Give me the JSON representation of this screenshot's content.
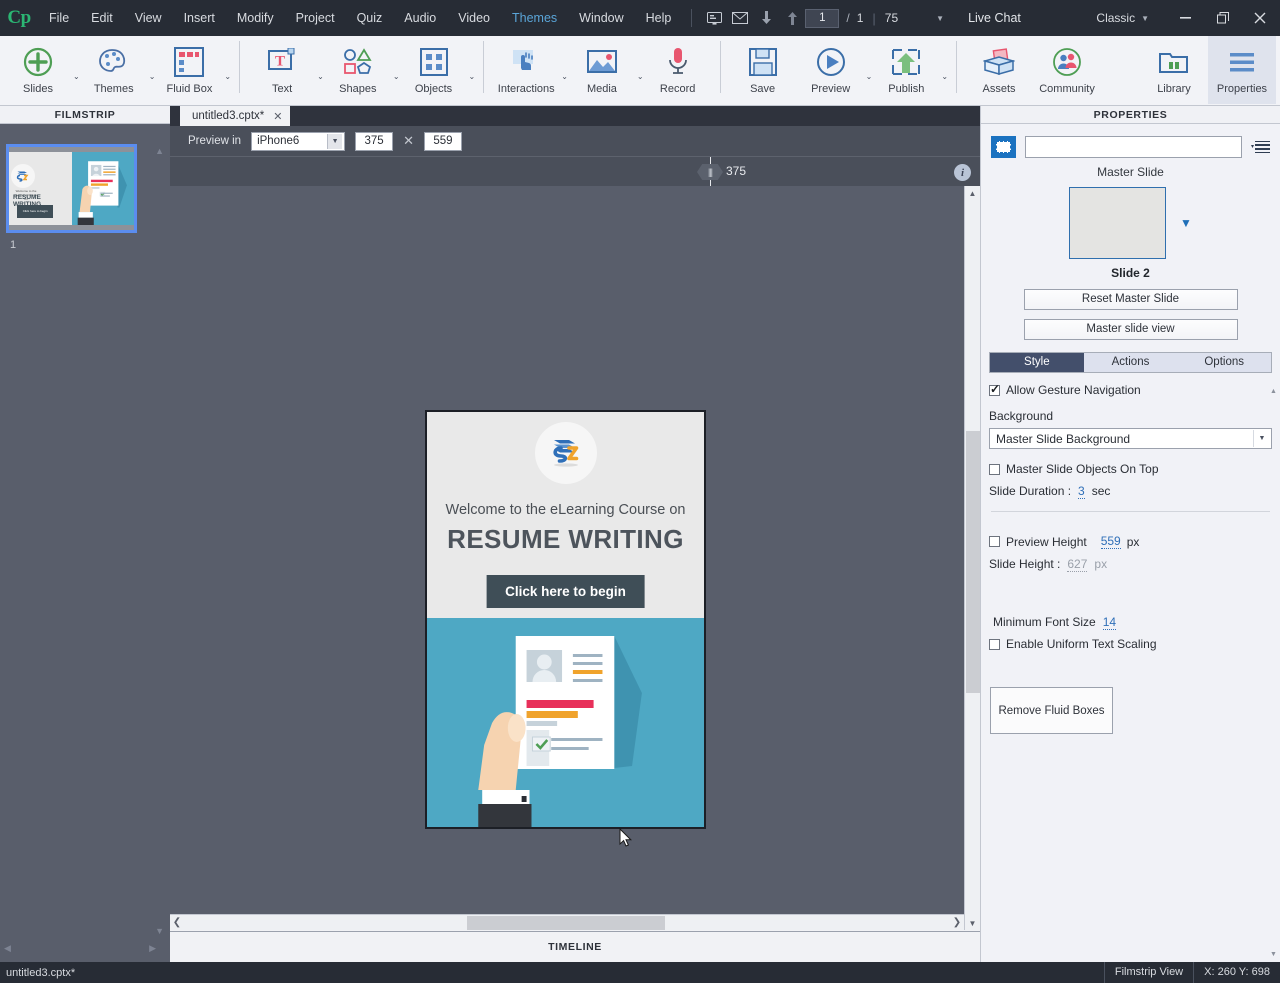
{
  "menubar": {
    "logo": "Cp",
    "items": [
      {
        "label": "File",
        "accent": false
      },
      {
        "label": "Edit",
        "accent": false
      },
      {
        "label": "View",
        "accent": false
      },
      {
        "label": "Insert",
        "accent": false
      },
      {
        "label": "Modify",
        "accent": false
      },
      {
        "label": "Project",
        "accent": false
      },
      {
        "label": "Quiz",
        "accent": false
      },
      {
        "label": "Audio",
        "accent": false
      },
      {
        "label": "Video",
        "accent": false
      },
      {
        "label": "Themes",
        "accent": true
      },
      {
        "label": "Window",
        "accent": false
      },
      {
        "label": "Help",
        "accent": false
      }
    ],
    "slide_current": "1",
    "slide_separator": "/",
    "slide_total": "1",
    "zoom": "75",
    "live_chat": "Live Chat",
    "workspace": "Classic",
    "icons": {
      "display": "display-icon",
      "mail": "mail-icon",
      "down": "arrow-down-icon",
      "up": "arrow-up-icon"
    },
    "window_controls": {
      "minimize": "–",
      "restore": "❐",
      "close": "✕"
    }
  },
  "ribbon": {
    "groups": [
      {
        "tools": [
          {
            "label": "Slides",
            "icon": "add-slide-icon",
            "caret": true,
            "active": false
          },
          {
            "label": "Themes",
            "icon": "palette-icon",
            "caret": true,
            "active": false
          },
          {
            "label": "Fluid Box",
            "icon": "fluid-box-icon",
            "caret": true,
            "active": false
          }
        ]
      },
      {
        "tools": [
          {
            "label": "Text",
            "icon": "text-icon",
            "caret": true,
            "active": false
          },
          {
            "label": "Shapes",
            "icon": "shapes-icon",
            "caret": true,
            "active": false
          },
          {
            "label": "Objects",
            "icon": "objects-icon",
            "caret": true,
            "active": false
          }
        ]
      },
      {
        "tools": [
          {
            "label": "Interactions",
            "icon": "interactions-icon",
            "caret": true,
            "active": false
          },
          {
            "label": "Media",
            "icon": "media-icon",
            "caret": true,
            "active": false
          },
          {
            "label": "Record",
            "icon": "microphone-icon",
            "caret": false,
            "active": false
          }
        ]
      },
      {
        "tools": [
          {
            "label": "Save",
            "icon": "save-icon",
            "caret": false,
            "active": false
          },
          {
            "label": "Preview",
            "icon": "preview-play-icon",
            "caret": true,
            "active": false
          },
          {
            "label": "Publish",
            "icon": "publish-upload-icon",
            "caret": true,
            "active": false
          }
        ]
      },
      {
        "tools": [
          {
            "label": "Assets",
            "icon": "assets-box-icon",
            "caret": false,
            "active": false
          },
          {
            "label": "Community",
            "icon": "community-people-icon",
            "caret": false,
            "active": false
          }
        ]
      }
    ],
    "right_tools": [
      {
        "label": "Library",
        "icon": "library-folder-icon",
        "caret": false,
        "active": false
      },
      {
        "label": "Properties",
        "icon": "properties-lines-icon",
        "caret": false,
        "active": true
      }
    ]
  },
  "filmstrip": {
    "title": "FILMSTRIP",
    "slides": [
      {
        "number": "1",
        "welcome": "Welcome to the eLearning Course on",
        "title": "RESUME WRITING",
        "button": "Click here to begin"
      }
    ]
  },
  "canvas": {
    "tab": {
      "label": "untitled3.cptx*",
      "close": "✕"
    },
    "preview_label": "Preview in",
    "device": "iPhone6",
    "width": "375",
    "times": "✕",
    "height": "559",
    "ruler_value": "375",
    "info_icon": "info-icon",
    "timeline_label": "TIMELINE"
  },
  "slide": {
    "logo_alt": "s2-logo-icon",
    "welcome": "Welcome to the eLearning Course on",
    "title": "RESUME WRITING",
    "cta": "Click here to begin",
    "illustration": "hand-holding-resume-illustration"
  },
  "properties": {
    "title": "PROPERTIES",
    "name_value": "",
    "swatch_icon": "fill-swatch-icon",
    "menu_icon": "panel-menu-icon",
    "master_slide_label": "Master Slide",
    "master_slide_name": "Slide 2",
    "reset_master": "Reset Master Slide",
    "master_slide_view": "Master slide view",
    "tabs": [
      {
        "label": "Style",
        "active": true
      },
      {
        "label": "Actions",
        "active": false
      },
      {
        "label": "Options",
        "active": false
      }
    ],
    "allow_gesture": "Allow Gesture Navigation",
    "allow_gesture_checked": true,
    "background_label": "Background",
    "background_value": "Master Slide Background",
    "master_objects_top": "Master Slide Objects On Top",
    "master_objects_checked": false,
    "slide_duration_label": "Slide Duration :",
    "slide_duration_value": "3",
    "slide_duration_unit": "sec",
    "preview_height_label": "Preview Height",
    "preview_height_checked": false,
    "preview_height_value": "559",
    "preview_height_unit": "px",
    "slide_height_label": "Slide Height :",
    "slide_height_value": "627",
    "slide_height_unit": "px",
    "min_font_label": "Minimum Font Size",
    "min_font_value": "14",
    "uniform_scaling": "Enable Uniform Text Scaling",
    "uniform_scaling_checked": false,
    "remove_fluid_boxes": "Remove Fluid Boxes"
  },
  "statusbar": {
    "file": "untitled3.cptx*",
    "view_mode": "Filmstrip View",
    "coords": "X: 260 Y: 698"
  },
  "colors": {
    "accent_blue": "#1b72c0",
    "tab_active": "#434f6b",
    "slide_teal": "#4ea8c4",
    "slide_dark": "#3f4e57",
    "chrome_dark": "#272c35",
    "stage_gray": "#595e6b"
  }
}
